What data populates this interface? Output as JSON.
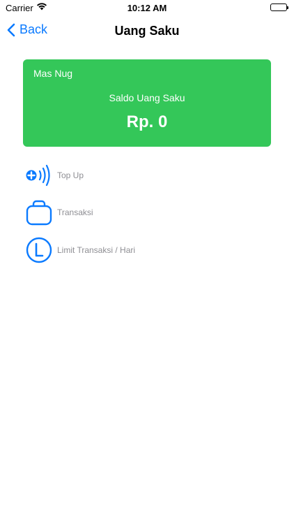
{
  "status_bar": {
    "carrier": "Carrier",
    "time": "10:12 AM"
  },
  "nav": {
    "back_label": "Back",
    "title": "Uang Saku"
  },
  "card": {
    "owner": "Mas Nug",
    "label": "Saldo Uang Saku",
    "amount": "Rp. 0",
    "color": "#34c759"
  },
  "menu": {
    "items": [
      {
        "label": "Top Up",
        "icon": "contactless-topup-icon"
      },
      {
        "label": "Transaksi",
        "icon": "shopping-bag-icon"
      },
      {
        "label": "Limit Transaksi / Hari",
        "icon": "limit-clock-icon"
      }
    ]
  },
  "colors": {
    "accent": "#0a7aff",
    "menu_label": "#8e8e93"
  }
}
